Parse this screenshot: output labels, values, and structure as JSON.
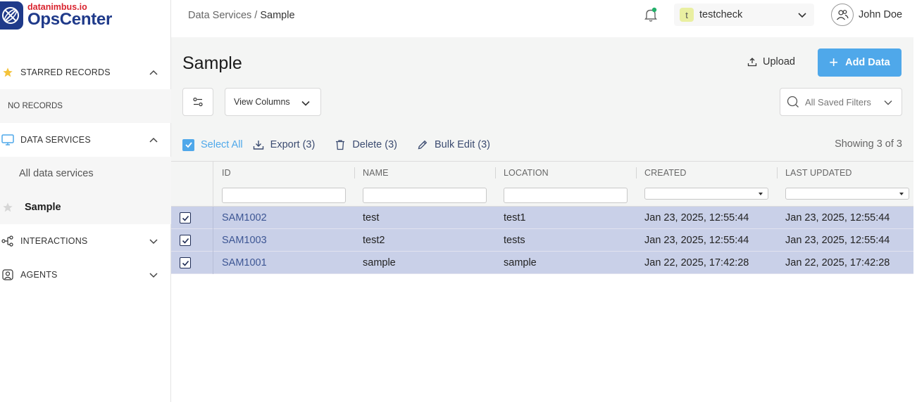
{
  "brand": {
    "small": "datanimbus.io",
    "big": "OpsCenter"
  },
  "sidebar": {
    "starred": {
      "label": "STARRED RECORDS",
      "empty": "NO RECORDS"
    },
    "data_services": {
      "label": "DATA SERVICES",
      "items": [
        {
          "label": "All data services"
        },
        {
          "label": "Sample"
        }
      ]
    },
    "interactions": {
      "label": "INTERACTIONS"
    },
    "agents": {
      "label": "AGENTS"
    }
  },
  "header": {
    "breadcrumb_parent": "Data Services",
    "breadcrumb_sep": " / ",
    "breadcrumb_current": "Sample",
    "tenant_initial": "t",
    "tenant_name": "testcheck",
    "user_name": "John Doe"
  },
  "page": {
    "title": "Sample",
    "upload_label": "Upload",
    "add_label": "Add Data",
    "view_columns_label": "View Columns",
    "saved_filters_placeholder": "All Saved Filters"
  },
  "bulk": {
    "select_all": "Select All",
    "export": "Export (3)",
    "delete": "Delete (3)",
    "bulk_edit": "Bulk Edit (3)",
    "showing": "Showing 3 of 3"
  },
  "table": {
    "columns": [
      "ID",
      "NAME",
      "LOCATION",
      "CREATED",
      "LAST UPDATED"
    ],
    "rows": [
      [
        "SAM1002",
        "test",
        "test1",
        "Jan 23, 2025, 12:55:44",
        "Jan 23, 2025, 12:55:44"
      ],
      [
        "SAM1003",
        "test2",
        "tests",
        "Jan 23, 2025, 12:55:44",
        "Jan 23, 2025, 12:55:44"
      ],
      [
        "SAM1001",
        "sample",
        "sample",
        "Jan 22, 2025, 17:42:28",
        "Jan 22, 2025, 17:42:28"
      ]
    ]
  },
  "colors": {
    "accent": "#4fa8ea",
    "brand": "#1f3a8a",
    "brand_red": "#d9232e",
    "row_selected": "#c9d0e8"
  }
}
